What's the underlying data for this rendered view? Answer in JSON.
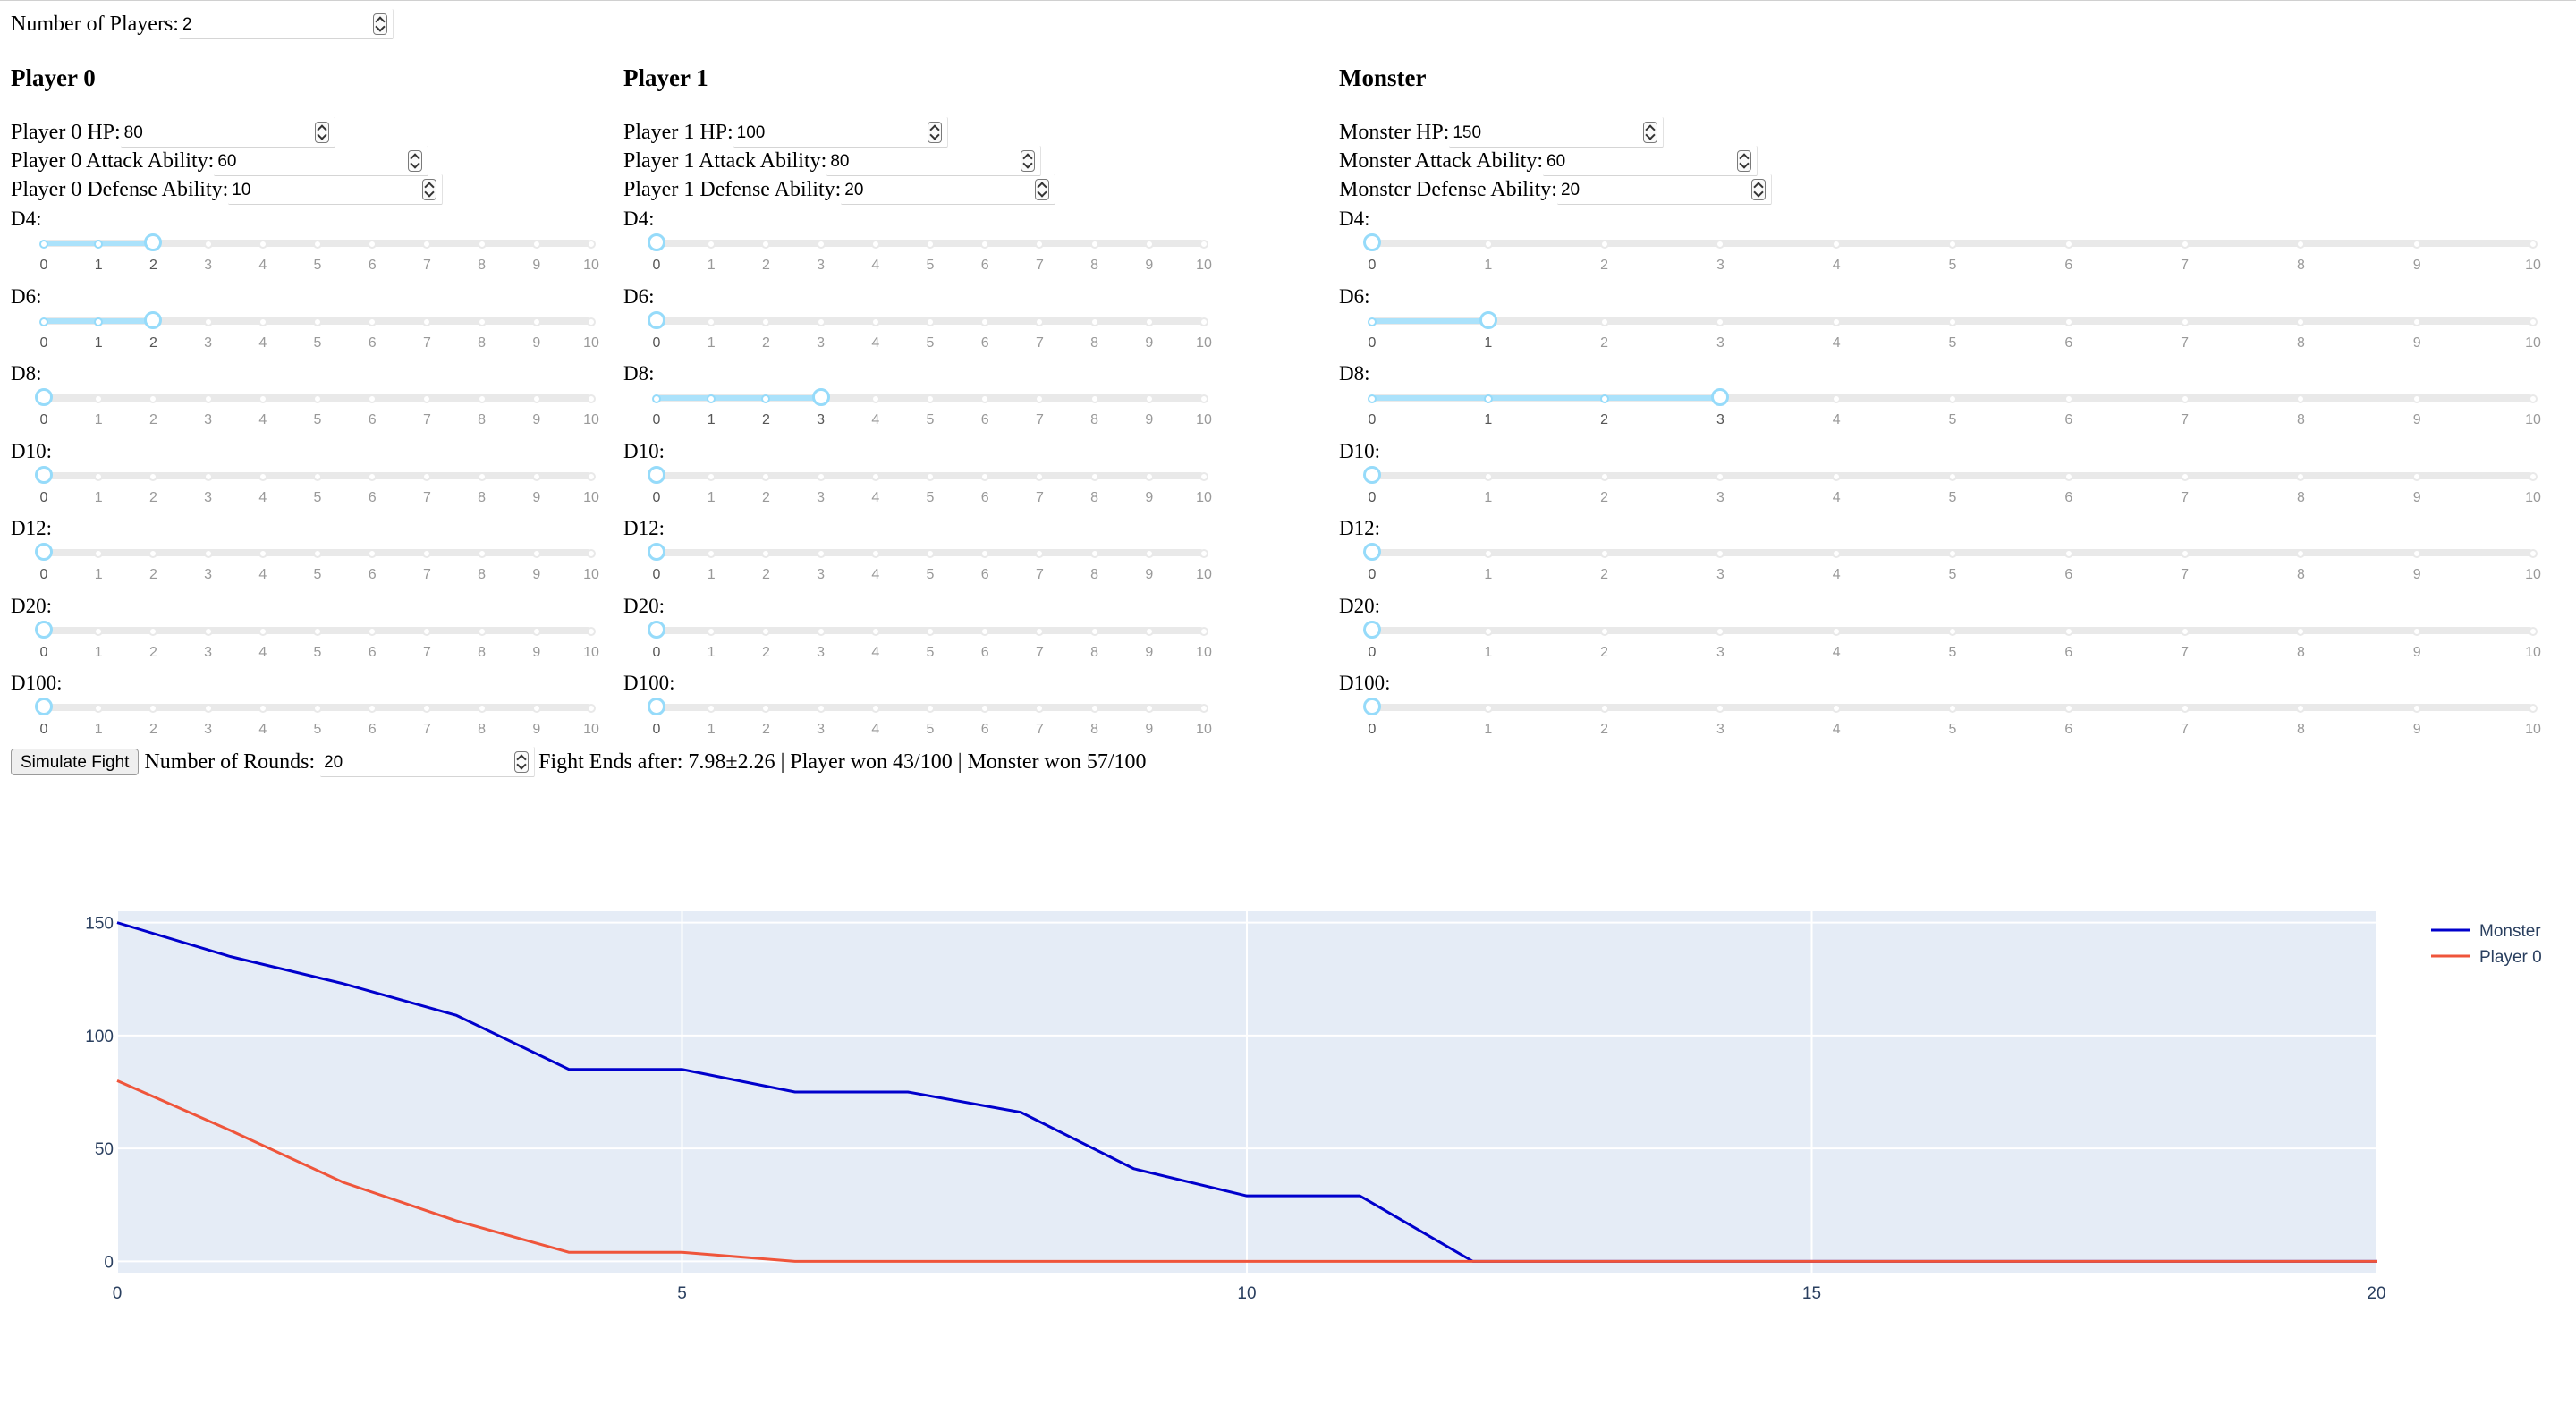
{
  "num_players": {
    "label": "Number of Players:",
    "value": "2"
  },
  "panels": [
    {
      "title": "Player 0",
      "hp": {
        "label": "Player 0 HP:",
        "value": "80"
      },
      "attack": {
        "label": "Player 0 Attack Ability:",
        "value": "60"
      },
      "defense": {
        "label": "Player 0 Defense Ability:",
        "value": "10"
      },
      "dice": [
        {
          "label": "D4:",
          "value": 2
        },
        {
          "label": "D6:",
          "value": 2
        },
        {
          "label": "D8:",
          "value": 0
        },
        {
          "label": "D10:",
          "value": 0
        },
        {
          "label": "D12:",
          "value": 0
        },
        {
          "label": "D20:",
          "value": 0
        },
        {
          "label": "D100:",
          "value": 0
        }
      ]
    },
    {
      "title": "Player 1",
      "hp": {
        "label": "Player 1 HP:",
        "value": "100"
      },
      "attack": {
        "label": "Player 1 Attack Ability:",
        "value": "80"
      },
      "defense": {
        "label": "Player 1 Defense Ability:",
        "value": "20"
      },
      "dice": [
        {
          "label": "D4:",
          "value": 0
        },
        {
          "label": "D6:",
          "value": 0
        },
        {
          "label": "D8:",
          "value": 3
        },
        {
          "label": "D10:",
          "value": 0
        },
        {
          "label": "D12:",
          "value": 0
        },
        {
          "label": "D20:",
          "value": 0
        },
        {
          "label": "D100:",
          "value": 0
        }
      ]
    },
    {
      "title": "Monster",
      "hp": {
        "label": "Monster HP:",
        "value": "150"
      },
      "attack": {
        "label": "Monster Attack Ability:",
        "value": "60"
      },
      "defense": {
        "label": "Monster Defense Ability:",
        "value": "20"
      },
      "dice": [
        {
          "label": "D4:",
          "value": 0
        },
        {
          "label": "D6:",
          "value": 1
        },
        {
          "label": "D8:",
          "value": 3
        },
        {
          "label": "D10:",
          "value": 0
        },
        {
          "label": "D12:",
          "value": 0
        },
        {
          "label": "D20:",
          "value": 0
        },
        {
          "label": "D100:",
          "value": 0
        }
      ]
    }
  ],
  "slider_marks": [
    "0",
    "1",
    "2",
    "3",
    "4",
    "5",
    "6",
    "7",
    "8",
    "9",
    "10"
  ],
  "slider_max": 10,
  "controls": {
    "simulate_label": "Simulate Fight",
    "rounds_label": "Number of Rounds:",
    "rounds_value": "20",
    "result_text": "Fight Ends after: 7.98±2.26 | Player won 43/100 | Monster won 57/100"
  },
  "colors": {
    "slider_rail": "#abe2fb",
    "slider_handle": "#96dbfa",
    "plot_bg": "#e5ecf6",
    "monster_line": "#0000cc",
    "player_line": "#ef553b"
  },
  "chart_data": {
    "type": "line",
    "xlim": [
      0,
      20
    ],
    "ylim": [
      -5,
      155
    ],
    "x_ticks": [
      0,
      5,
      10,
      15,
      20
    ],
    "y_ticks": [
      0,
      50,
      100,
      150
    ],
    "grid": true,
    "legend_placement": "top-right",
    "series": [
      {
        "name": "Monster",
        "color": "#0000cc",
        "x": [
          0,
          1,
          2,
          3,
          4,
          5,
          6,
          7,
          8,
          9,
          10,
          11,
          12,
          13,
          14,
          15,
          16,
          17,
          18,
          19,
          20
        ],
        "y": [
          150,
          135,
          123,
          109,
          85,
          85,
          75,
          75,
          66,
          41,
          29,
          29,
          0,
          0,
          0,
          0,
          0,
          0,
          0,
          0,
          0
        ]
      },
      {
        "name": "Player 0",
        "color": "#ef553b",
        "x": [
          0,
          1,
          2,
          3,
          4,
          5,
          6,
          7,
          8,
          9,
          10,
          11,
          12,
          13,
          14,
          15,
          16,
          17,
          18,
          19,
          20
        ],
        "y": [
          80,
          58,
          35,
          18,
          4,
          4,
          0,
          0,
          0,
          0,
          0,
          0,
          0,
          0,
          0,
          0,
          0,
          0,
          0,
          0,
          0
        ]
      }
    ]
  }
}
